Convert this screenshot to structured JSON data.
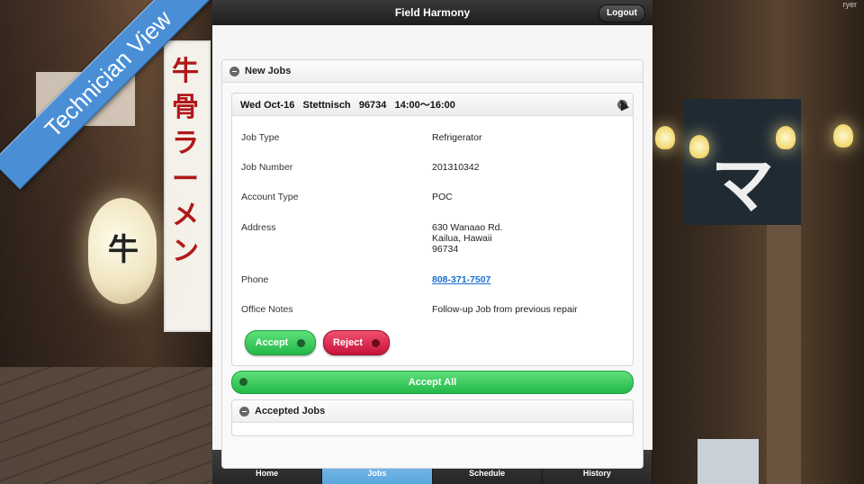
{
  "overlay": {
    "ribbon_text": "Technician View",
    "corner_text": "ryer"
  },
  "background_signs": {
    "lantern": "牛",
    "banner": "牛骨ラーメン",
    "noren_mark": "マ"
  },
  "app": {
    "title": "Field Harmony",
    "logout_label": "Logout",
    "new_jobs_label": "New Jobs",
    "job": {
      "header": "Wed Oct-16   Stettnisch   96734   14:00～16:00",
      "fields": {
        "job_type_label": "Job Type",
        "job_type": "Refrigerator",
        "job_number_label": "Job Number",
        "job_number": "201310342",
        "account_type_label": "Account Type",
        "account_type": "POC",
        "address_label": "Address",
        "address_line1": "630 Wanaao Rd.",
        "address_line2": "Kailua, Hawaii",
        "address_line3": "96734",
        "phone_label": "Phone",
        "phone": "808-371-7507",
        "office_notes_label": "Office Notes",
        "office_notes": "Follow-up Job from previous repair"
      },
      "accept_label": "Accept",
      "reject_label": "Reject"
    },
    "accept_all_label": "Accept All",
    "accepted_jobs_label": "Accepted Jobs",
    "tabs": [
      "Home",
      "Jobs",
      "Schedule",
      "History"
    ],
    "active_tab": "Jobs",
    "colors": {
      "accept": "#22b84a",
      "reject": "#c8123a",
      "active_tab": "#5aa6df",
      "topbar": "#1e1e1e"
    }
  }
}
